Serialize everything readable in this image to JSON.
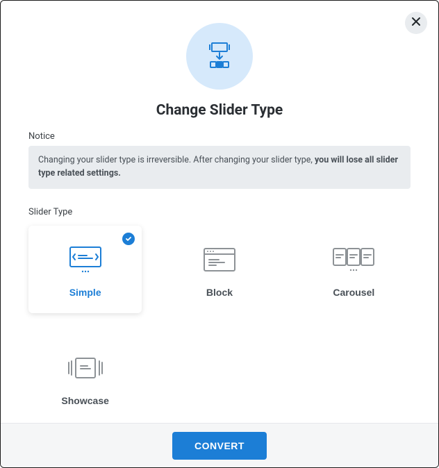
{
  "modal": {
    "title": "Change Slider Type",
    "notice_label": "Notice",
    "notice_text_1": "Changing your slider type is irreversible. After changing your slider type, ",
    "notice_text_bold": "you will lose all slider type related settings.",
    "section_label": "Slider Type",
    "convert_label": "CONVERT",
    "options": [
      {
        "id": "simple",
        "label": "Simple",
        "selected": true
      },
      {
        "id": "block",
        "label": "Block",
        "selected": false
      },
      {
        "id": "carousel",
        "label": "Carousel",
        "selected": false
      },
      {
        "id": "showcase",
        "label": "Showcase",
        "selected": false
      }
    ]
  }
}
